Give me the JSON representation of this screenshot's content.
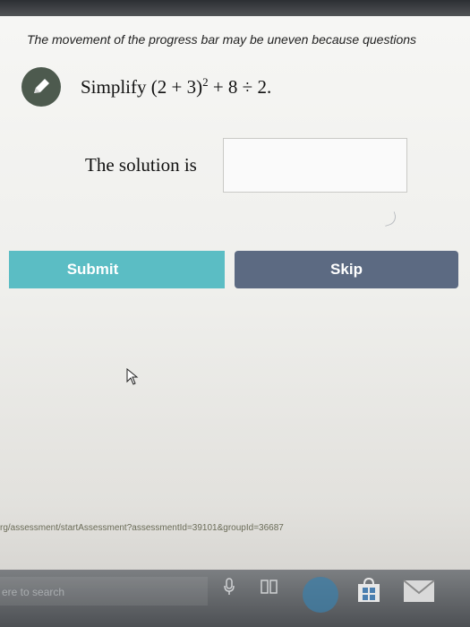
{
  "header": {
    "notice": "The movement of the progress bar may be uneven because questions"
  },
  "question": {
    "icon": "pencil-icon",
    "prefix": "Simplify (2 + 3)",
    "exponent": "2",
    "suffix": " + 8 ÷ 2."
  },
  "answer": {
    "label": "The solution is",
    "value": ""
  },
  "buttons": {
    "submit_label": "Submit",
    "skip_label": "Skip"
  },
  "status_bar": {
    "url": "rg/assessment/startAssessment?assessmentId=39101&groupId=36687"
  },
  "taskbar": {
    "search_placeholder": "ere to search",
    "icons": [
      "microphone-icon",
      "task-view-icon",
      "edge-icon",
      "store-icon",
      "mail-icon"
    ]
  },
  "colors": {
    "submit": "#5bbdc4",
    "skip": "#5c6a82",
    "badge": "#4d5a4e"
  }
}
